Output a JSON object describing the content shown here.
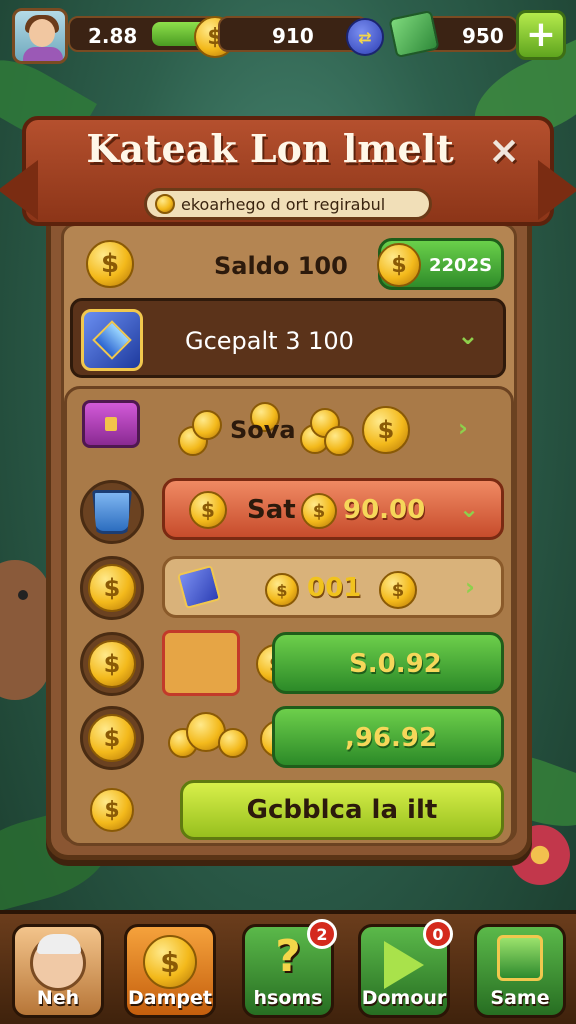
{
  "hud": {
    "coins_value": "2.88",
    "gems_value": "910",
    "cash_value": "950",
    "plus_label": "+",
    "blue_icon": "double-arrow-icon"
  },
  "dialog": {
    "title": "Kateak Lon lmelt",
    "close_label": "×",
    "subtitle": "ekoarhego d ort regirabul",
    "saldo_label": "Saldo 100",
    "saldo_value": "2202S",
    "dropdown_label": "Gcepalt 3 100",
    "rows": [
      {
        "label": "Sova",
        "icon": "treasure-chest-icon"
      },
      {
        "label": "Sat",
        "value": "90.00",
        "icon": "bucket-icon"
      },
      {
        "value": "001",
        "icon": "coin-icon"
      },
      {
        "value": "S.0.92",
        "icon": "coin-icon"
      },
      {
        "value": ",96.92",
        "icon": "coin-icon"
      }
    ],
    "cta_label": "Gcbblca la ilt"
  },
  "nav": [
    {
      "label": "Neh",
      "badge": ""
    },
    {
      "label": "Dampet",
      "badge": ""
    },
    {
      "label": "hsoms",
      "badge": "2"
    },
    {
      "label": "Domour",
      "badge": "0"
    },
    {
      "label": "Same",
      "badge": ""
    }
  ],
  "colors": {
    "panel": "#8a5632",
    "ribbon": "#b5502e",
    "accent_green": "#4a9b22",
    "coin": "#f3b91b"
  }
}
